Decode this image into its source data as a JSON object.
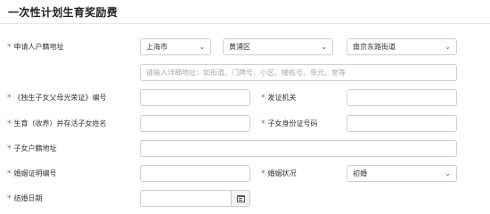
{
  "section_title": "一次性计划生育奖励费",
  "required_mark": "*",
  "fields": {
    "address_label": "申请人户籍地址",
    "city": "上海市",
    "district": "黄浦区",
    "street": "南京东路街道",
    "detail_placeholder": "请输入详细地址：如街道、门牌号、小区、楼栋号、单元、室等",
    "cert_no_label": "《独生子女父母光荣证》编号",
    "issuer_label": "发证机关",
    "child_name_label": "生育（收养）并存活子女姓名",
    "child_id_label": "子女身份证号码",
    "child_address_label": "子女户籍地址",
    "marriage_cert_label": "婚姻证明编号",
    "marital_status_label": "婚姻状况",
    "marital_status": "初婚",
    "marriage_date_label": "结婚日期"
  }
}
